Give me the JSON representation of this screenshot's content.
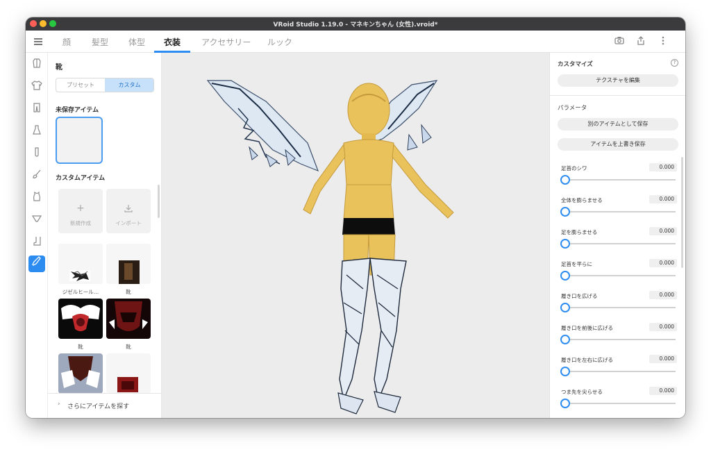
{
  "window": {
    "title": "VRoid Studio 1.19.0 - マネキンちゃん (女性).vroid*"
  },
  "tabs": [
    {
      "label": "顔"
    },
    {
      "label": "髪型"
    },
    {
      "label": "体型"
    },
    {
      "label": "衣装"
    },
    {
      "label": "アクセサリー"
    },
    {
      "label": "ルック"
    }
  ],
  "active_tab": "衣装",
  "left_panel": {
    "title": "靴",
    "segment": {
      "preset": "プリセット",
      "custom": "カスタム",
      "selected": "カスタム"
    },
    "unsaved_label": "未保存アイテム",
    "custom_label": "カスタムアイテム",
    "new_label": "新規作成",
    "import_label": "インポート",
    "items": [
      {
        "caption": "ジゼルヒール…"
      },
      {
        "caption": "靴"
      },
      {
        "caption": "靴"
      },
      {
        "caption": "靴"
      }
    ],
    "footer": "さらにアイテムを探す"
  },
  "right_panel": {
    "customize_label": "カスタマイズ",
    "edit_texture": "テクスチャを編集",
    "params_label": "パラメータ",
    "save_as_new": "別のアイテムとして保存",
    "overwrite": "アイテムを上書き保存",
    "params": [
      {
        "name": "足首のシワ",
        "value": "0.000"
      },
      {
        "name": "全体を膨らませる",
        "value": "0.000"
      },
      {
        "name": "足を膨らませる",
        "value": "0.000"
      },
      {
        "name": "足首を平らに",
        "value": "0.000"
      },
      {
        "name": "履き口を広げる",
        "value": "0.000"
      },
      {
        "name": "履き口を前後に広げる",
        "value": "0.000"
      },
      {
        "name": "履き口を左右に広げる",
        "value": "0.000"
      },
      {
        "name": "つま先を尖らせる",
        "value": "0.000"
      }
    ]
  },
  "colors": {
    "accent": "#2d8cf0",
    "titlebar": "#3b3b3d",
    "viewport_bg": "#ececec"
  }
}
